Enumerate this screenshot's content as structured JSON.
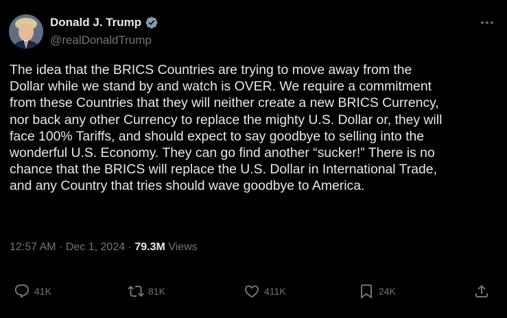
{
  "author": {
    "display_name": "Donald J. Trump",
    "handle": "@realDonaldTrump",
    "verified": true,
    "verified_color": "#829aab"
  },
  "tweet": {
    "text": "The idea that the BRICS Countries are trying to move away from the\nDollar while we stand by and watch is OVER. We require a commitment\nfrom these Countries that they will neither create a new BRICS Currency,\nnor back any other Currency to replace the mighty U.S. Dollar or, they will\nface 100% Tariffs, and should expect to say goodbye to selling into the\nwonderful U.S. Economy. They can go find another “sucker!” There is no\nchance that the BRICS will replace the U.S. Dollar in International Trade,\nand any Country that tries should wave goodbye to America."
  },
  "meta": {
    "time": "12:57 AM",
    "separator": " · ",
    "date": "Dec 1, 2024",
    "views_count": "79.3M",
    "views_label": " Views"
  },
  "actions": {
    "replies": "41K",
    "reposts": "81K",
    "likes": "411K",
    "bookmarks": "24K"
  },
  "icons": {
    "more": "more-horizontal-icon",
    "reply": "reply-icon",
    "repost": "repost-icon",
    "like": "heart-icon",
    "bookmark": "bookmark-icon",
    "share": "share-icon"
  },
  "colors": {
    "background": "#000000",
    "text": "#e7e9ea",
    "secondary": "#71767b"
  }
}
